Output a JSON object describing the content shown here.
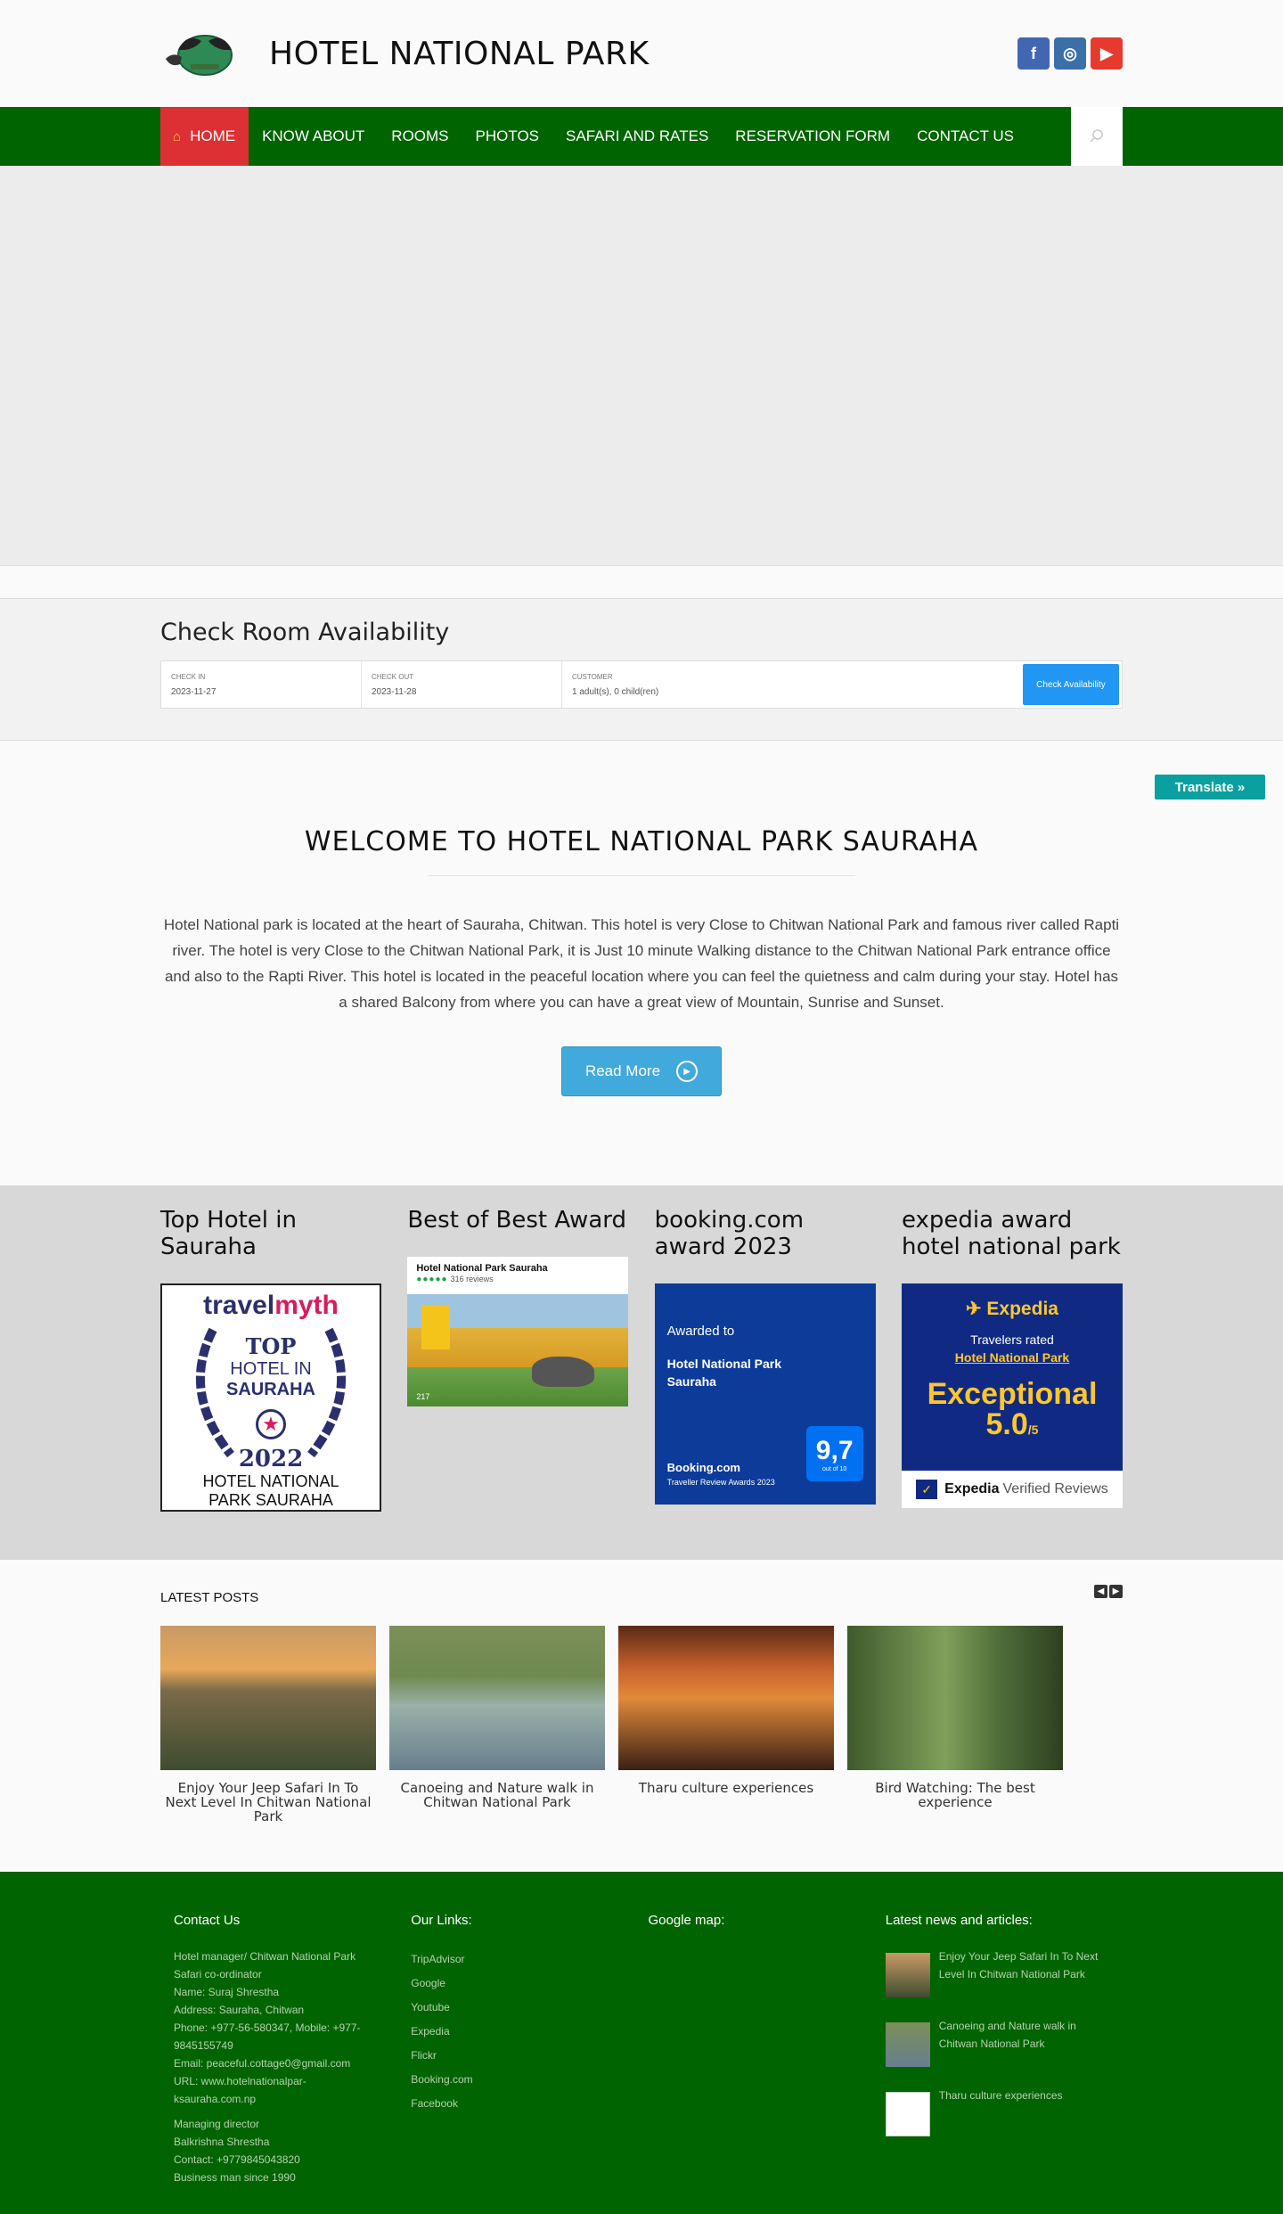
{
  "header": {
    "site_title": "HOTEL NATIONAL PARK",
    "social": {
      "facebook": "f",
      "instagram": "◎",
      "youtube": "▶"
    }
  },
  "nav": {
    "items": [
      "HOME",
      "KNOW ABOUT",
      "ROOMS",
      "PHOTOS",
      "SAFARI AND RATES",
      "RESERVATION FORM",
      "CONTACT US"
    ],
    "active_color": "#dc3034",
    "bar_color": "#006400"
  },
  "availability": {
    "title": "Check Room Availability",
    "check_in_label": "CHECK IN",
    "check_in_value": "2023-11-27",
    "check_out_label": "CHECK OUT",
    "check_out_value": "2023-11-28",
    "customer_label": "CUSTOMER",
    "customer_value": "1 adult(s), 0 child(ren)",
    "button": "Check Availability"
  },
  "translate": "Translate »",
  "welcome": {
    "title": "WELCOME TO HOTEL NATIONAL PARK SAURAHA",
    "body": "Hotel National park is located at the heart of Sauraha, Chitwan. This hotel is very Close to Chitwan National Park and famous river called Rapti river. The hotel is very Close to the Chitwan National Park, it is Just 10 minute Walking distance to the Chitwan National Park entrance office and also to the Rapti River. This hotel is located in the peaceful location where you can feel the quietness and calm during your stay. Hotel has a shared Balcony from where you can have a great view of Mountain, Sunrise and Sunset.",
    "read_more": "Read More"
  },
  "awards": [
    {
      "title": "Top Hotel in Sauraha",
      "badge": {
        "brand_a": "travel",
        "brand_b": "myth",
        "top": "TOP",
        "line1": "HOTEL IN",
        "line2": "SAURAHA",
        "year": "2022",
        "name1": "HOTEL NATIONAL",
        "name2": "PARK SAURAHA"
      }
    },
    {
      "title": "Best of Best Award",
      "badge": {
        "name": "Hotel National Park Sauraha",
        "dots": "●●●●●",
        "reviews": "316 reviews",
        "count": "217"
      }
    },
    {
      "title": "booking.com award 2023",
      "badge": {
        "awarded": "Awarded to",
        "hotel1": "Hotel National Park",
        "hotel2": "Sauraha",
        "brand": "Booking.com",
        "sub": "Traveller Review Awards 2023",
        "score": "9,7",
        "out_of": "out of 10"
      }
    },
    {
      "title": "expedia award hotel national park",
      "badge": {
        "logo": "Expedia",
        "rated": "Travelers rated",
        "hotel": "Hotel National Park",
        "label": "Exceptional",
        "score": "5.0",
        "scale": "/5",
        "verified_brand": "Expedia",
        "verified": "Verified Reviews"
      }
    }
  ],
  "latest_posts": {
    "title": "LATEST POSTS",
    "items": [
      {
        "title": "Enjoy Your Jeep Safari In To Next Level In Chitwan National Park"
      },
      {
        "title": "Canoeing and Nature walk in Chitwan National Park"
      },
      {
        "title": "Tharu culture experiences"
      },
      {
        "title": "Bird Watching: The best experience"
      }
    ]
  },
  "footer": {
    "contact_title": "Contact Us",
    "contact_lines": [
      "Hotel manager/ Chitwan National Park",
      "Safari co-ordinator",
      "Name: Suraj Shrestha",
      "Address: Sauraha, Chitwan",
      "Phone: +977-56-580347, Mobile: +977-",
      "9845155749",
      "Email: peaceful.cottage0@gmail.com",
      "URL: www.hotelnationalpar-",
      "ksauraha.com.np"
    ],
    "director_lines": [
      "Managing director",
      "Balkrishna Shrestha",
      "Contact: +9779845043820",
      "Business man since 1990"
    ],
    "links_title": "Our Links:",
    "links": [
      "TripAdvisor",
      "Google",
      "Youtube",
      "Expedia",
      "Flickr",
      "Booking.com",
      "Facebook"
    ],
    "map_title": "Google map:",
    "news_title": "Latest news and articles:",
    "news": [
      "Enjoy Your Jeep Safari In To Next Level In Chitwan National Park",
      "Canoeing and Nature walk in Chitwan National Park",
      "Tharu culture experiences"
    ]
  }
}
